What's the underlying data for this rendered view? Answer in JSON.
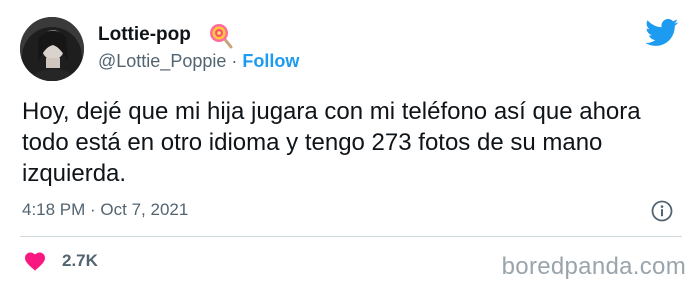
{
  "user": {
    "display_name": "Lottie-pop",
    "handle": "@Lottie_Poppie",
    "separator": "·",
    "follow_label": "Follow",
    "badge_icon": "lollipop-emoji"
  },
  "tweet": {
    "text": "Hoy, dejé que mi hija jugara con mi teléfono así que ahora todo está en otro idioma y tengo 273 fotos de su mano izquierda.",
    "timestamp": "4:18 PM · Oct 7, 2021",
    "likes": "2.7K"
  },
  "icons": {
    "brand": "twitter-bird-icon",
    "info": "info-icon",
    "like": "heart-icon"
  },
  "colors": {
    "twitter_blue": "#1d9bf0",
    "heart_pink": "#f91880",
    "text_primary": "#0f1419",
    "text_secondary": "#536471"
  },
  "watermark": "boredpanda.com"
}
